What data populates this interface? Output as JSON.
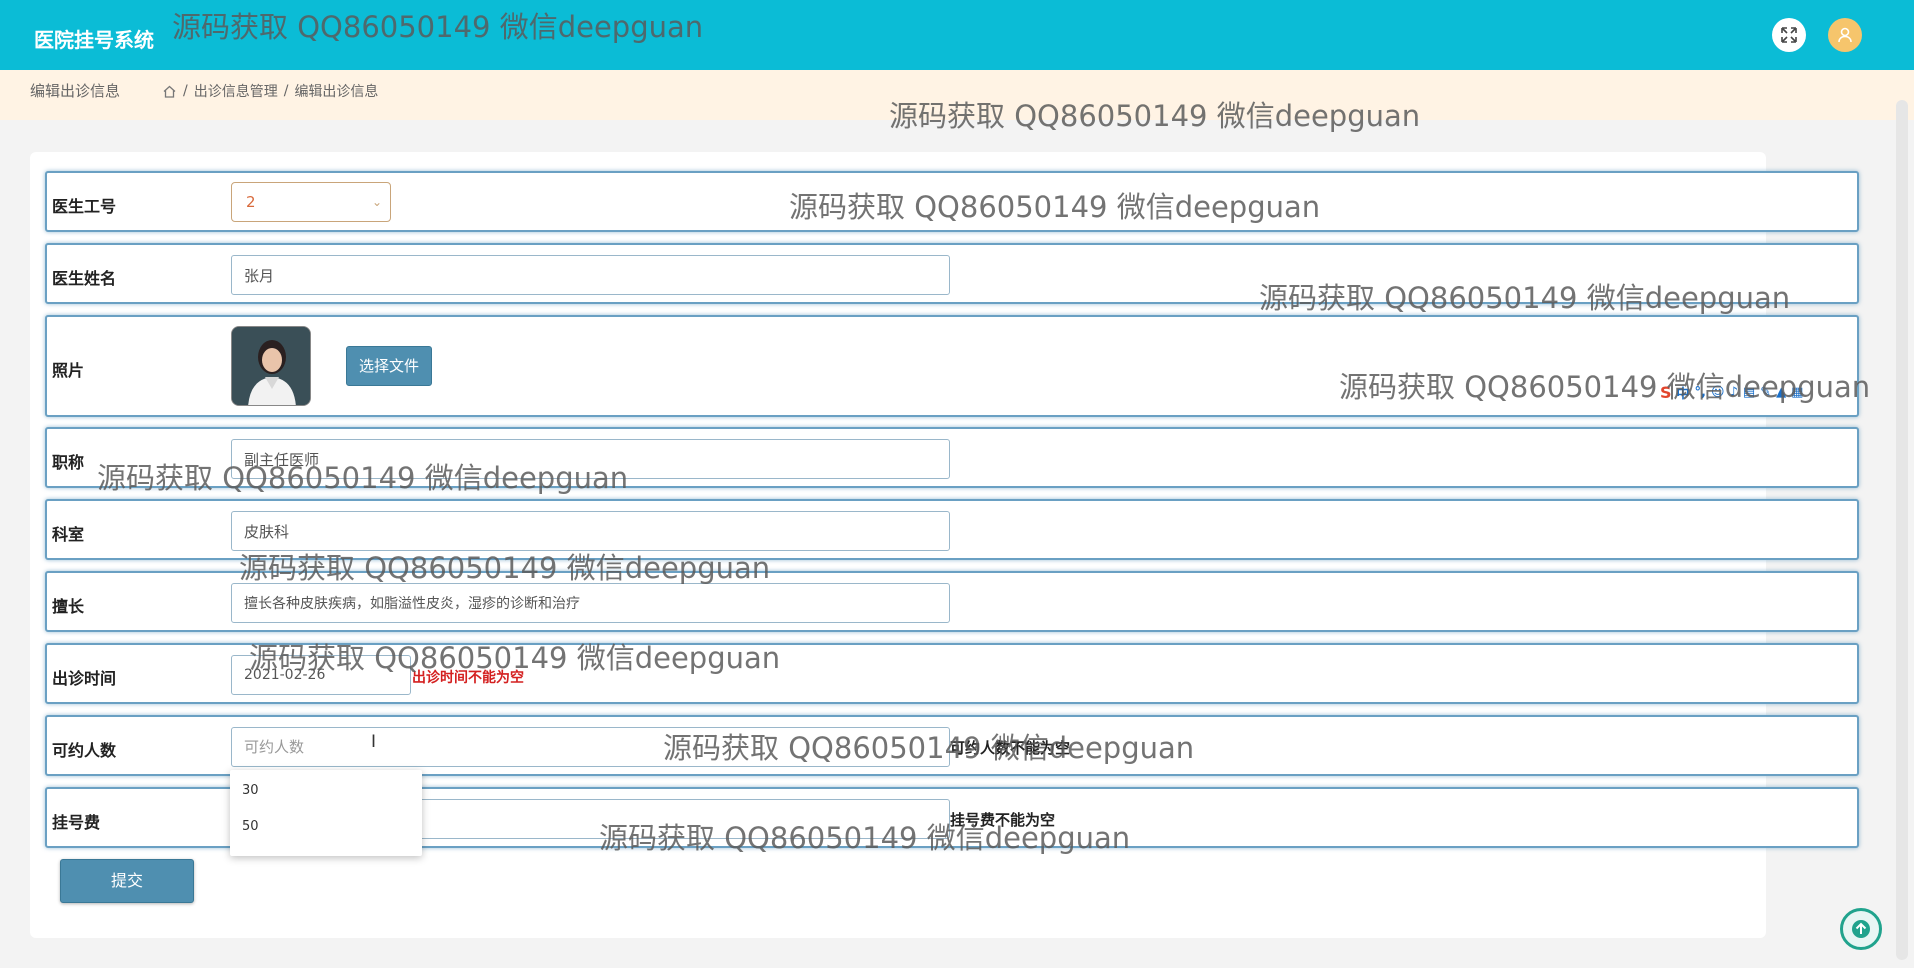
{
  "header": {
    "app_title": "医院挂号系统"
  },
  "breadcrumb": {
    "page_title": "编辑出诊信息",
    "items": [
      "出诊信息管理",
      "编辑出诊信息"
    ],
    "separator": "/"
  },
  "form": {
    "doctor_id": {
      "label": "医生工号",
      "value": "2"
    },
    "doctor_name": {
      "label": "医生姓名",
      "value": "张月"
    },
    "photo": {
      "label": "照片",
      "button": "选择文件"
    },
    "title": {
      "label": "职称",
      "value": "副主任医师"
    },
    "department": {
      "label": "科室",
      "value": "皮肤科"
    },
    "specialty": {
      "label": "擅长",
      "value": "擅长各种皮肤疾病，如脂溢性皮炎，湿疹的诊断和治疗"
    },
    "visit_time": {
      "label": "出诊时间",
      "value": "2021-02-26",
      "error": "出诊时间不能为空"
    },
    "capacity": {
      "label": "可约人数",
      "placeholder": "可约人数",
      "error": "可约人数不能为空",
      "suggestions": [
        "30",
        "50"
      ]
    },
    "fee": {
      "label": "挂号费",
      "value": "",
      "error": "挂号费不能为空"
    },
    "submit": "提交"
  },
  "watermark": "源码获取 QQ86050149 微信deepguan",
  "ime_toolbar": {
    "lang": "中"
  },
  "colors": {
    "header": "#0bbcd6",
    "breadcrumb_bg": "#fff3e4",
    "button": "#4f8fb0",
    "error": "#d42020",
    "row_border": "#6aa0c3"
  }
}
